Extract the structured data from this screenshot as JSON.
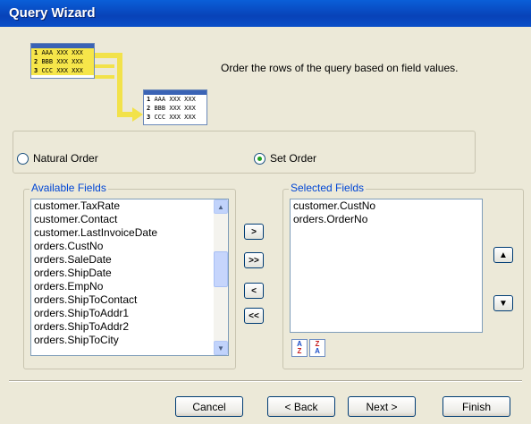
{
  "window": {
    "title": "Query Wizard"
  },
  "graphic": {
    "top_rows": [
      {
        "num": "1",
        "code": "AAA",
        "rest": "XXX XXX"
      },
      {
        "num": "2",
        "code": "BBB",
        "rest": "XXX XXX"
      },
      {
        "num": "3",
        "code": "CCC",
        "rest": "XXX XXX"
      }
    ],
    "bottom_rows": [
      {
        "num": "1",
        "code": "AAA",
        "rest": "XXX XXX"
      },
      {
        "num": "2",
        "code": "BBB",
        "rest": "XXX XXX"
      },
      {
        "num": "3",
        "code": "CCC",
        "rest": "XXX XXX"
      }
    ]
  },
  "instructions": "Order the rows of the query based on field values.",
  "order": {
    "natural_label": "Natural Order",
    "set_label": "Set Order",
    "selected": "set"
  },
  "available": {
    "legend": "Available Fields",
    "items": [
      "customer.TaxRate",
      "customer.Contact",
      "customer.LastInvoiceDate",
      "orders.CustNo",
      "orders.SaleDate",
      "orders.ShipDate",
      "orders.EmpNo",
      "orders.ShipToContact",
      "orders.ShipToAddr1",
      "orders.ShipToAddr2",
      "orders.ShipToCity"
    ]
  },
  "move_buttons": {
    "add": ">",
    "add_all": ">>",
    "remove": "<",
    "remove_all": "<<"
  },
  "selected": {
    "legend": "Selected Fields",
    "items": [
      "customer.CustNo",
      "orders.OrderNo"
    ]
  },
  "sort": {
    "asc_top": "A",
    "asc_bottom": "Z",
    "desc_top": "Z",
    "desc_bottom": "A"
  },
  "buttons": {
    "cancel": "Cancel",
    "back": "< Back",
    "next": "Next >",
    "finish": "Finish"
  }
}
